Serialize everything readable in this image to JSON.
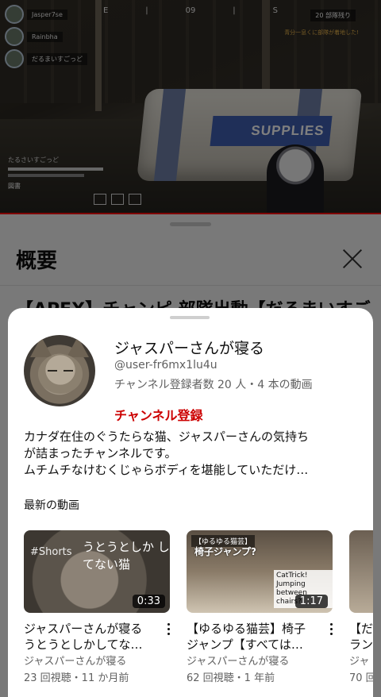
{
  "video": {
    "hud": {
      "compass": [
        "E",
        "|",
        "|",
        "S"
      ],
      "compass_value": "09",
      "players": [
        "Jasper7se",
        "Rainbha",
        "だるまいすごっど"
      ],
      "top_right": "20 部隊残り",
      "message": "青分一息くに部隊が着地した!",
      "squad_label": "たるさいすごっど",
      "self_name": "図書"
    },
    "crate_label": "SUPPLIES"
  },
  "panel": {
    "title": "概要",
    "video_title_partial": "【APEX】チャンピ 部隊出動【だるまいすご"
  },
  "channel": {
    "name": "ジャスパーさんが寝る",
    "handle": "@user-fr6mx1lu4u",
    "stats": "チャンネル登録者数 20 人・4 本の動画",
    "subscribe_label": "チャンネル登録",
    "description_lines": [
      "カナダ在住のぐうたらな猫、ジャスパーさんの気持ち",
      "が詰まったチャンネルです。",
      "ムチムチなけむくじゃらボディを堪能していただけ…"
    ],
    "latest_label": "最新の動画",
    "videos": [
      {
        "title_lines": [
          "ジャスパーさんが寝る",
          "うとうとしかしてな…"
        ],
        "channel": "ジャスパーさんが寝る",
        "meta": "23 回視聴・11 か月前",
        "duration": "0:33",
        "thumb_text": "うとうとしか してない猫",
        "thumb_tag": "#Shorts"
      },
      {
        "title_lines": [
          "【ゆるゆる猫芸】椅子",
          "ジャンプ【すべては…"
        ],
        "channel": "ジャスパーさんが寝る",
        "meta": "62 回視聴・1 年前",
        "duration": "1:17",
        "thumb_tag": "【ゆるゆる猫芸】",
        "thumb_text": "椅子ジャンプ?",
        "thumb_note": "CatTrick! Jumping between chairs?"
      },
      {
        "title_lines": [
          "【だ",
          "ラン"
        ],
        "channel": "ジャ",
        "meta": "70 回"
      }
    ]
  },
  "colors": {
    "subscribe": "#cc0000",
    "progress": "#ff0000",
    "secondary_text": "#606060"
  }
}
